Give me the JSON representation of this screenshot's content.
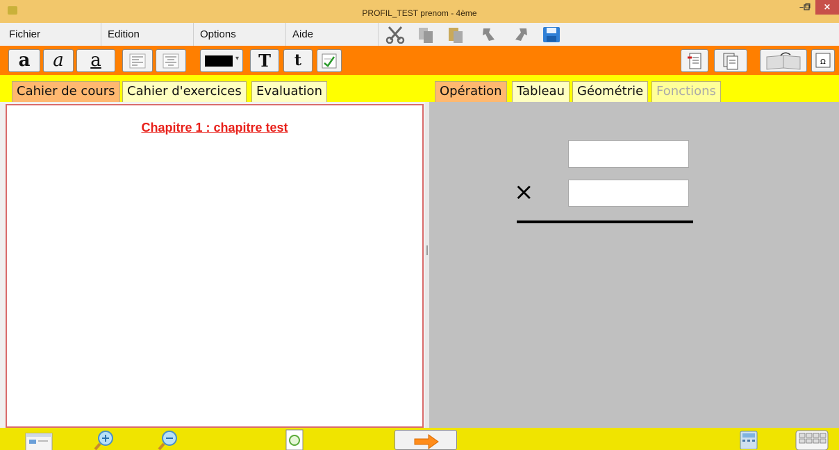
{
  "window": {
    "title": "PROFIL_TEST prenom - 4ème",
    "minimize_glyph": "–",
    "maximize_glyph": "▫",
    "close_glyph": "×"
  },
  "menu": {
    "items": [
      {
        "label": "Fichier"
      },
      {
        "label": "Edition"
      },
      {
        "label": "Options"
      },
      {
        "label": "Aide"
      }
    ]
  },
  "toolbar": {
    "bold_label": "a",
    "italic_label": "a",
    "underline_label": "a",
    "large_text_label": "T",
    "small_text_label": "t",
    "text_color": "#000000"
  },
  "left_tabs": {
    "items": [
      {
        "label": "Cahier de cours"
      },
      {
        "label": "Cahier d'exercices"
      },
      {
        "label": "Evaluation"
      }
    ],
    "active": "Cahier de cours"
  },
  "right_tabs": {
    "items": [
      {
        "label": "Opération"
      },
      {
        "label": "Tableau"
      },
      {
        "label": "Géométrie"
      },
      {
        "label": "Fonctions"
      }
    ],
    "active": "Opération",
    "disabled": "Fonctions"
  },
  "document": {
    "chapter_title": "Chapitre 1 : chapitre test"
  },
  "operation": {
    "operator": "×",
    "operand1": "",
    "operand2": ""
  },
  "colors": {
    "titlebar": "#f2c76b",
    "toolbar": "#ff7f00",
    "tabbar": "#ffff00",
    "active_tab": "#ffb870",
    "chapter_title": "#e8201a",
    "operation_bg": "#c0c0c0",
    "bottombar": "#f0e400"
  }
}
